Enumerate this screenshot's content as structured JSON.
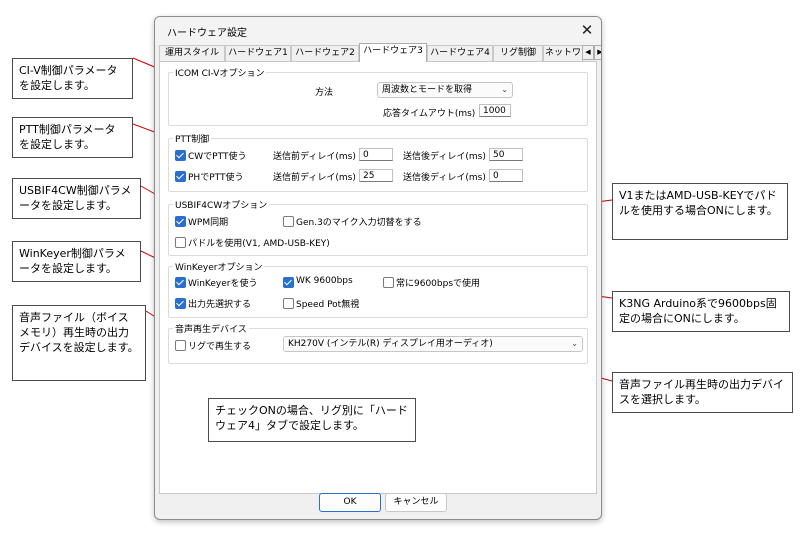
{
  "dialog": {
    "title": "ハードウェア設定",
    "tabs": [
      {
        "label": "運用スタイル"
      },
      {
        "label": "ハードウェア1"
      },
      {
        "label": "ハードウェア2"
      },
      {
        "label": "ハードウェア3"
      },
      {
        "label": "ハードウェア4"
      },
      {
        "label": "リグ制御"
      },
      {
        "label": "ネットワ"
      }
    ],
    "active_tab": "ハードウェア3",
    "icom": {
      "legend": "ICOM CI-Vオプション",
      "method_label": "方法",
      "method_value": "周波数とモードを取得",
      "timeout_label": "応答タイムアウト(ms)",
      "timeout_value": "1000"
    },
    "ptt": {
      "legend": "PTT制御",
      "cw_label": "CWでPTT使う",
      "ph_label": "PHでPTT使う",
      "before_label": "送信前ディレイ(ms)",
      "after_label": "送信後ディレイ(ms)",
      "cw_before": "0",
      "cw_after": "50",
      "ph_before": "25",
      "ph_after": "0"
    },
    "usbif": {
      "legend": "USBIF4CWオプション",
      "wpm_label": "WPM同期",
      "gen3_label": "Gen.3のマイク入力切替をする",
      "paddle_label": "パドルを使用(V1, AMD-USB-KEY)"
    },
    "winkeyer": {
      "legend": "WinKeyerオプション",
      "use_label": "WinKeyerを使う",
      "wk9600_label": "WK 9600bps",
      "always9600_label": "常に9600bpsで使用",
      "output_label": "出力先選択する",
      "speedpot_label": "Speed Pot無視"
    },
    "audio": {
      "legend": "音声再生デバイス",
      "perrig_label": "リグで再生する",
      "device_value": "KH270V (インテル(R) ディスプレイ用オーディオ)"
    },
    "ok_label": "OK",
    "cancel_label": "キャンセル"
  },
  "callouts": {
    "civ": "CI-V制御パラメータを設定します。",
    "ptt": "PTT制御パラメータを設定します。",
    "usbif": "USBIF4CW制御パラメータを設定します。",
    "winkeyer": "WinKeyer制御パラメータを設定します。",
    "voice": "音声ファイル（ボイスメモリ）再生時の出力デバイスを設定します。",
    "v1": "V1またはAMD-USB-KEYでパドルを使用する場合ONにします。",
    "k3ng": "K3NG Arduino系で9600bps固定の場合にONにします。",
    "device": "音声ファイル再生時の出力デバイスを選択します。",
    "rig": "チェックONの場合、リグ別に「ハードウェア4」タブで設定します。"
  },
  "colors": {
    "accent": "#2a6fd0",
    "callout_line": "#cc0000"
  }
}
